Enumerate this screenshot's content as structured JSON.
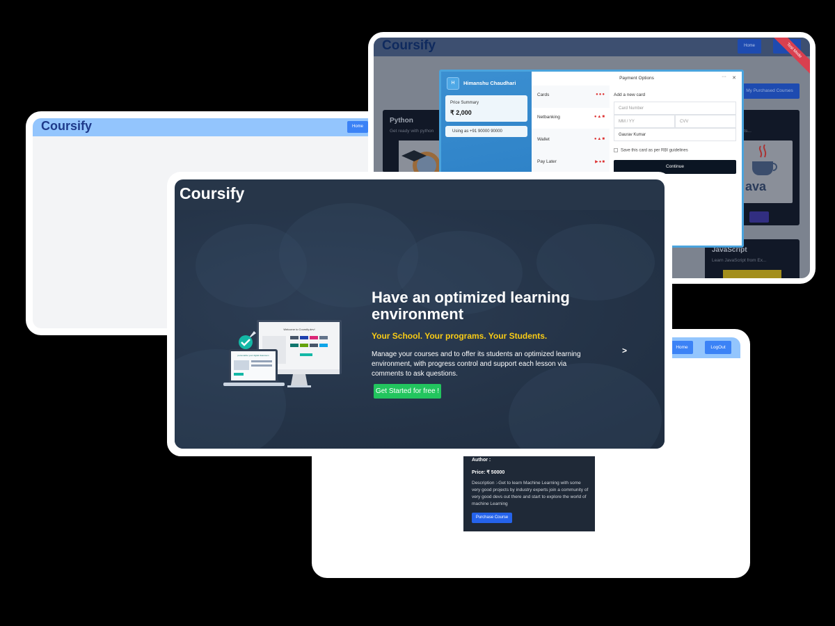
{
  "frame_blank": {
    "logo": "Coursify",
    "home_label": "Home"
  },
  "frame_courses": {
    "logo": "Coursify",
    "home_label": "Home",
    "ribbon": "Test Mode",
    "my_purchased_label": "My Purchased Courses",
    "courses": [
      {
        "title": "Python",
        "description": "Get ready with python"
      },
      {
        "title": "",
        "description": "h Experts..."
      },
      {
        "title": "JavaScript",
        "description": "Learn JavaScript from Ex..."
      }
    ],
    "java_word": "ava",
    "payment": {
      "avatar_letter": "H",
      "user_name": "Himanshu Chaudhari",
      "price_summary_label": "Price Summary",
      "price_amount": "₹ 2,000",
      "using_as": "Using as +91 90000 90000",
      "title": "Payment Options",
      "methods": [
        "Cards",
        "Netbanking",
        "Wallet",
        "Pay Later"
      ],
      "add_new_card": "Add a new card",
      "card_number_placeholder": "Card Number",
      "expiry_placeholder": "MM / YY",
      "cvv_placeholder": "CVV",
      "card_holder": "Gaurav Kumar",
      "save_card_label": "Save this card as per RBI guidelines",
      "continue_label": "Continue"
    }
  },
  "frame_detail": {
    "home_label": "Home",
    "logout_label": "LogOut",
    "author_label": "Author :",
    "price_label": "Price: ₹ 50000",
    "description": "Description :-Get to learn Machine Learning with some very good projects by industry experts join a community of very good devs out there and start to explore the world of machine Learning",
    "purchase_label": "Purchase Course"
  },
  "hero": {
    "logo": "Coursify",
    "headline": "Have an optimized learning environment",
    "tagline": "Your School. Your programs. Your Students.",
    "description": "Manage your courses and to offer its students an optimized learning environment, with progress control and support each lesson via comments to ask questions.",
    "cta_label": "Get Started for free !",
    "next_label": ">",
    "illustration": {
      "monitor_title": "Welcome to Coursify.dev!",
      "laptop_title": "personalize your digital classroom"
    }
  },
  "colors": {
    "background": "#000000",
    "nav_light_blue": "#93c5fd",
    "brand_dark_blue": "#1e3a8a",
    "hero_bg": "#273649",
    "tagline_yellow": "#facc15",
    "cta_green": "#22c55e",
    "button_blue": "#3b82f6"
  }
}
